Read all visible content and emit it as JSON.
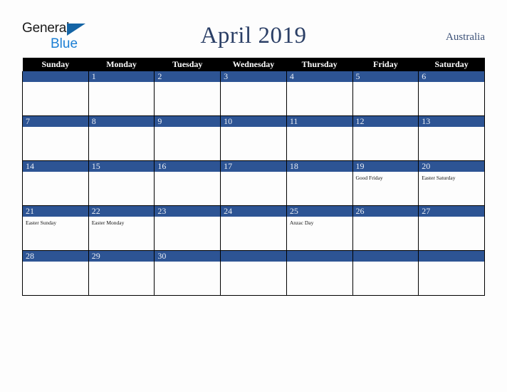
{
  "brand": {
    "name_part1": "General",
    "name_part2": "Blue",
    "triangle_icon": "triangle-icon"
  },
  "header": {
    "title": "April 2019",
    "region": "Australia"
  },
  "colors": {
    "day_band": "#2d5494",
    "header_row": "#000000",
    "title_text": "#2b3f66",
    "region_text": "#3c5178",
    "brand_blue": "#1b7fd4",
    "page_background": "#fdfdfd"
  },
  "calendar": {
    "month": "April",
    "year": "2019",
    "weekday_headers": [
      "Sunday",
      "Monday",
      "Tuesday",
      "Wednesday",
      "Thursday",
      "Friday",
      "Saturday"
    ],
    "weeks": [
      [
        {
          "day": "",
          "event": ""
        },
        {
          "day": "1",
          "event": ""
        },
        {
          "day": "2",
          "event": ""
        },
        {
          "day": "3",
          "event": ""
        },
        {
          "day": "4",
          "event": ""
        },
        {
          "day": "5",
          "event": ""
        },
        {
          "day": "6",
          "event": ""
        }
      ],
      [
        {
          "day": "7",
          "event": ""
        },
        {
          "day": "8",
          "event": ""
        },
        {
          "day": "9",
          "event": ""
        },
        {
          "day": "10",
          "event": ""
        },
        {
          "day": "11",
          "event": ""
        },
        {
          "day": "12",
          "event": ""
        },
        {
          "day": "13",
          "event": ""
        }
      ],
      [
        {
          "day": "14",
          "event": ""
        },
        {
          "day": "15",
          "event": ""
        },
        {
          "day": "16",
          "event": ""
        },
        {
          "day": "17",
          "event": ""
        },
        {
          "day": "18",
          "event": ""
        },
        {
          "day": "19",
          "event": "Good Friday"
        },
        {
          "day": "20",
          "event": "Easter Saturday"
        }
      ],
      [
        {
          "day": "21",
          "event": "Easter Sunday"
        },
        {
          "day": "22",
          "event": "Easter Monday"
        },
        {
          "day": "23",
          "event": ""
        },
        {
          "day": "24",
          "event": ""
        },
        {
          "day": "25",
          "event": "Anzac Day"
        },
        {
          "day": "26",
          "event": ""
        },
        {
          "day": "27",
          "event": ""
        }
      ],
      [
        {
          "day": "28",
          "event": ""
        },
        {
          "day": "29",
          "event": ""
        },
        {
          "day": "30",
          "event": ""
        },
        {
          "day": "",
          "event": ""
        },
        {
          "day": "",
          "event": ""
        },
        {
          "day": "",
          "event": ""
        },
        {
          "day": "",
          "event": ""
        }
      ]
    ]
  }
}
